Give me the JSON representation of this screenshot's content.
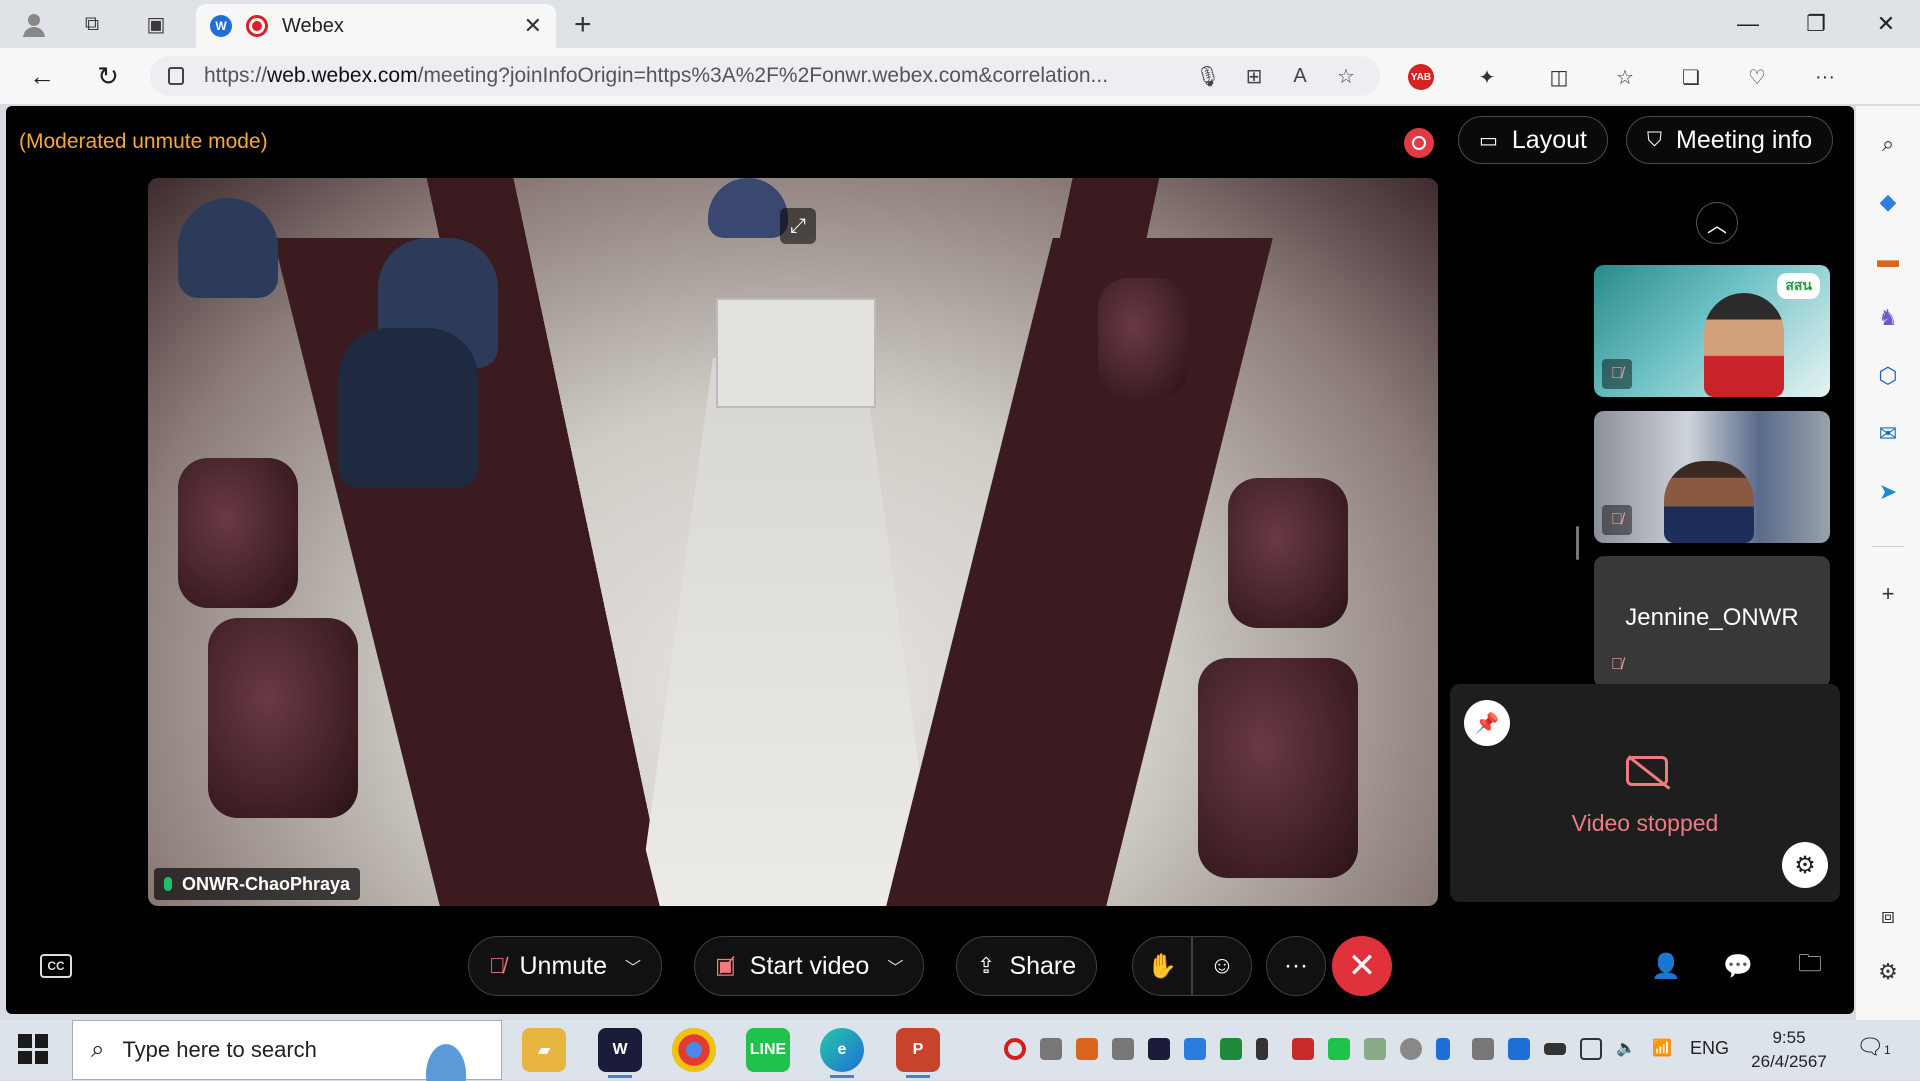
{
  "browser": {
    "tab_title": "Webex",
    "url_host": "web.webex.com",
    "url_prefix": "https://",
    "url_path": "/meeting?joinInfoOrigin=https%3A%2F%2Fonwr.webex.com&correlation..."
  },
  "meeting": {
    "mode_label": "(Moderated unmute mode)",
    "layout_label": "Layout",
    "meeting_info_label": "Meeting info",
    "active_speaker_name": "ONWR-ChaoPhraya",
    "thumbnails": [
      {
        "name": "",
        "muted": true,
        "logo": "สสน"
      },
      {
        "name": "",
        "muted": true
      },
      {
        "name": "Jennine_ONWR",
        "muted": true
      }
    ],
    "self_view_status": "Video stopped"
  },
  "controls": {
    "unmute_label": "Unmute",
    "start_video_label": "Start video",
    "share_label": "Share"
  },
  "taskbar": {
    "search_placeholder": "Type here to search",
    "language": "ENG",
    "time": "9:55",
    "date": "26/4/2567",
    "notification_count": "1"
  },
  "colors": {
    "mode_text": "#f3a93a",
    "muted_red": "#f07a82",
    "end_call": "#e0323c"
  }
}
